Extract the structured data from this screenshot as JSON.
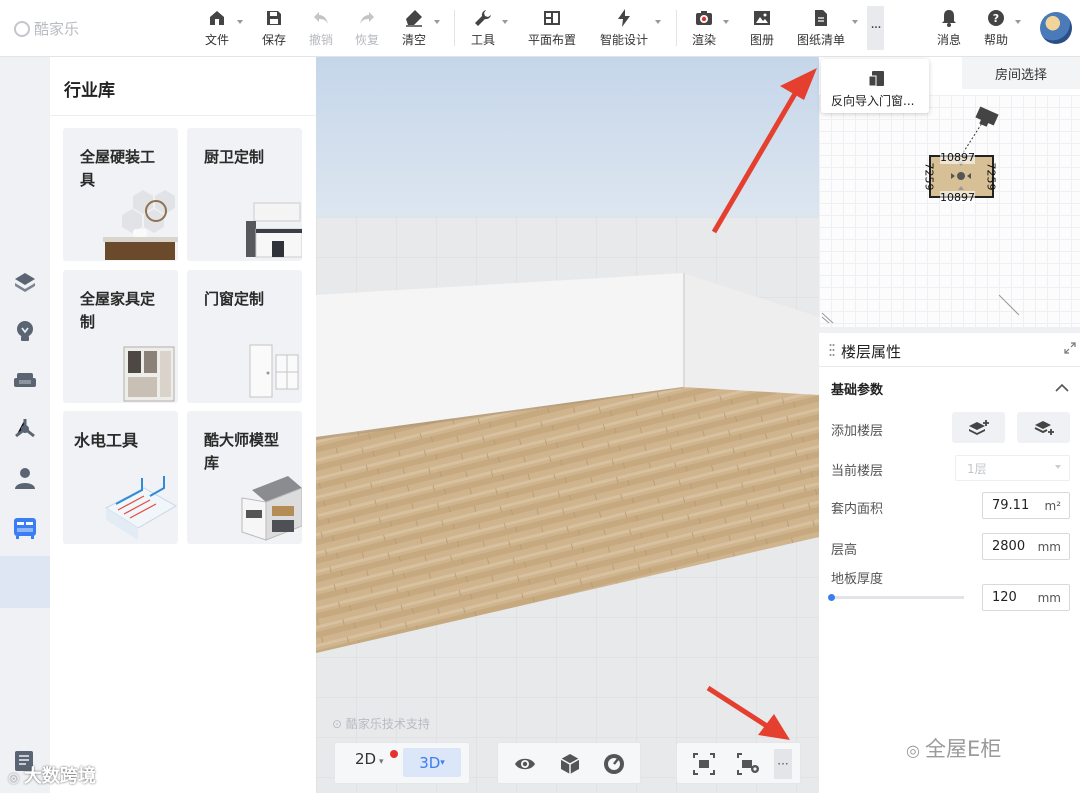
{
  "app": {
    "logo_text": "酷家乐"
  },
  "toolbar": {
    "items": [
      {
        "label": "文件",
        "icon": "home-icon",
        "disabled": false
      },
      {
        "label": "保存",
        "icon": "save-icon",
        "disabled": false
      },
      {
        "label": "撤销",
        "icon": "undo-icon",
        "disabled": true
      },
      {
        "label": "恢复",
        "icon": "redo-icon",
        "disabled": true
      },
      {
        "label": "清空",
        "icon": "eraser-icon",
        "disabled": false
      },
      {
        "label": "工具",
        "icon": "wrench-icon",
        "disabled": false
      },
      {
        "label": "平面布置",
        "icon": "layout-icon",
        "disabled": false
      },
      {
        "label": "智能设计",
        "icon": "lightning-icon",
        "disabled": false
      },
      {
        "label": "渲染",
        "icon": "camera-icon",
        "disabled": false
      },
      {
        "label": "图册",
        "icon": "image-icon",
        "disabled": false
      },
      {
        "label": "图纸清单",
        "icon": "document-icon",
        "disabled": false
      }
    ],
    "more_label": "···",
    "messages_label": "消息",
    "help_label": "帮助"
  },
  "library": {
    "title": "行业库",
    "cards": [
      {
        "label": "全屋硬装工具"
      },
      {
        "label": "厨卫定制"
      },
      {
        "label": "全屋家具定制"
      },
      {
        "label": "门窗定制"
      },
      {
        "label": "水电工具"
      },
      {
        "label": "酷大师模型库"
      }
    ]
  },
  "viewport": {
    "watermark": "酷家乐技术支持"
  },
  "bottombar": {
    "mode_2d": "2D",
    "mode_3d": "3D",
    "more_label": "···"
  },
  "minimap": {
    "room_tab": "房间选择",
    "tooltip": "反向导入门窗...",
    "dim_top": "10897",
    "dim_bottom": "10897",
    "dim_left": "7259",
    "dim_right": "7259"
  },
  "properties": {
    "title": "楼层属性",
    "section": "基础参数",
    "add_floor_label": "添加楼层",
    "current_floor_label": "当前楼层",
    "current_floor_value": "1层",
    "area_label": "套内面积",
    "area_value": "79.11",
    "area_unit": "m²",
    "height_label": "层高",
    "height_value": "2800",
    "height_unit": "mm",
    "thickness_label": "地板厚度",
    "thickness_value": "120",
    "thickness_unit": "mm"
  },
  "watermarks": {
    "right": "全屋E柜",
    "left": "大数跨境"
  },
  "colors": {
    "accent": "#3b7ef3",
    "arrow": "#e5402f",
    "alert_dot": "#e5322d"
  }
}
